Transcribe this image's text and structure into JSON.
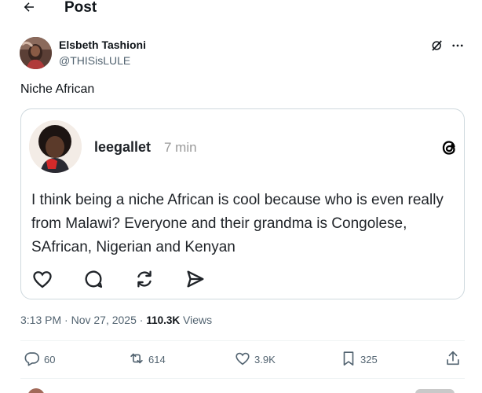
{
  "header": {
    "title": "Post"
  },
  "post": {
    "author_name": "Elsbeth Tashioni",
    "author_handle": "@THISisLULE",
    "text": "Niche African",
    "time": "3:13 PM",
    "separator": " · ",
    "date": "Nov 27, 2025",
    "separator2": " · ",
    "views_count": "110.3K",
    "views_label": " Views"
  },
  "embed": {
    "username": "leegallet",
    "time": "7 min",
    "text": "I think being a niche African is cool because who is even really from Malawi? Everyone and their grandma is Congolese, SAfrican, Nigerian and Kenyan",
    "icons": [
      "heart-outline-icon",
      "comment-bubble-icon",
      "repost-icon",
      "share-send-icon"
    ]
  },
  "actions": {
    "replies": "60",
    "reposts": "614",
    "likes": "3.9K",
    "bookmarks": "325"
  },
  "colors": {
    "text_primary": "#0f1419",
    "text_secondary": "#536471",
    "border": "#cfd9de",
    "divider": "#eff3f4"
  }
}
